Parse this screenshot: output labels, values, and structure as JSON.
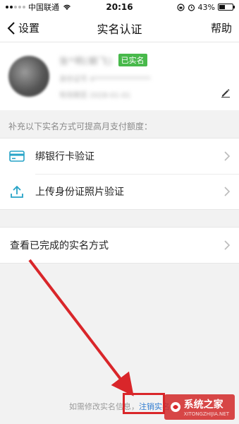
{
  "status_bar": {
    "carrier": "中国联通",
    "time": "20:16",
    "battery": "43%",
    "battery_level": 0.43
  },
  "nav": {
    "back_label": "设置",
    "title": "实名认证",
    "help_label": "帮助"
  },
  "profile": {
    "name_blurred": "张*明(朝飞)",
    "verified_badge": "已实名",
    "detail_blurred": "身份证号 4****************",
    "sub_blurred": "有效期至 2028-01-01"
  },
  "hint": "补充以下实名方式可提高月支付额度：",
  "methods": [
    {
      "label": "绑银行卡验证",
      "icon": "bank-card-icon"
    },
    {
      "label": "上传身份证照片验证",
      "icon": "upload-icon"
    }
  ],
  "completed": {
    "label": "查看已完成的实名方式"
  },
  "footer": {
    "prefix": "如需修改实名信息，",
    "link": "注销实名"
  },
  "watermark": {
    "text": "系统之家",
    "sub": "XITONGZHIJIA.NET"
  },
  "colors": {
    "accent_green": "#48b94b",
    "link_blue": "#2f7bd0",
    "annotation_red": "#d9262a",
    "icon_teal": "#27a3c7"
  }
}
